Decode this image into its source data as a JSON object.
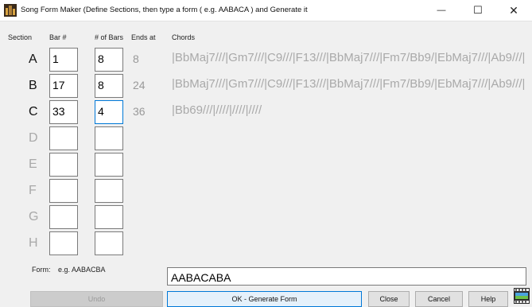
{
  "window": {
    "title": "Song Form Maker (Define Sections, then type a form ( e.g. AABACA ) and Generate it",
    "minimize_glyph": "—",
    "maximize_glyph": "☐",
    "close_glyph": "✕"
  },
  "headers": {
    "section": "Section",
    "bar": "Bar #",
    "num_bars": "# of Bars",
    "ends_at": "Ends at",
    "chords": "Chords"
  },
  "rows": [
    {
      "letter": "A",
      "bar": "1",
      "bars": "8",
      "ends": "8",
      "chords": "|BbMaj7///|Gm7///|C9///|F13///|BbMaj7///|Fm7/Bb9/|EbMaj7///|Ab9///|"
    },
    {
      "letter": "B",
      "bar": "17",
      "bars": "8",
      "ends": "24",
      "chords": "|BbMaj7///|Gm7///|C9///|F13///|BbMaj7///|Fm7/Bb9/|EbMaj7///|Ab9///|"
    },
    {
      "letter": "C",
      "bar": "33",
      "bars": "4",
      "ends": "36",
      "chords": "|Bb69///|////|////|////"
    },
    {
      "letter": "D",
      "bar": "",
      "bars": "",
      "ends": "",
      "chords": ""
    },
    {
      "letter": "E",
      "bar": "",
      "bars": "",
      "ends": "",
      "chords": ""
    },
    {
      "letter": "F",
      "bar": "",
      "bars": "",
      "ends": "",
      "chords": ""
    },
    {
      "letter": "G",
      "bar": "",
      "bars": "",
      "ends": "",
      "chords": ""
    },
    {
      "letter": "H",
      "bar": "",
      "bars": "",
      "ends": "",
      "chords": ""
    }
  ],
  "form": {
    "label": "Form:",
    "hint": "e.g. AABACBA",
    "value": "AABACABA"
  },
  "buttons": {
    "undo": "Undo",
    "generate": "OK - Generate Form",
    "close": "Close",
    "cancel": "Cancel",
    "help": "Help"
  },
  "colors": {
    "accent": "#0078d7",
    "inactive_text": "#a9a9a9"
  }
}
